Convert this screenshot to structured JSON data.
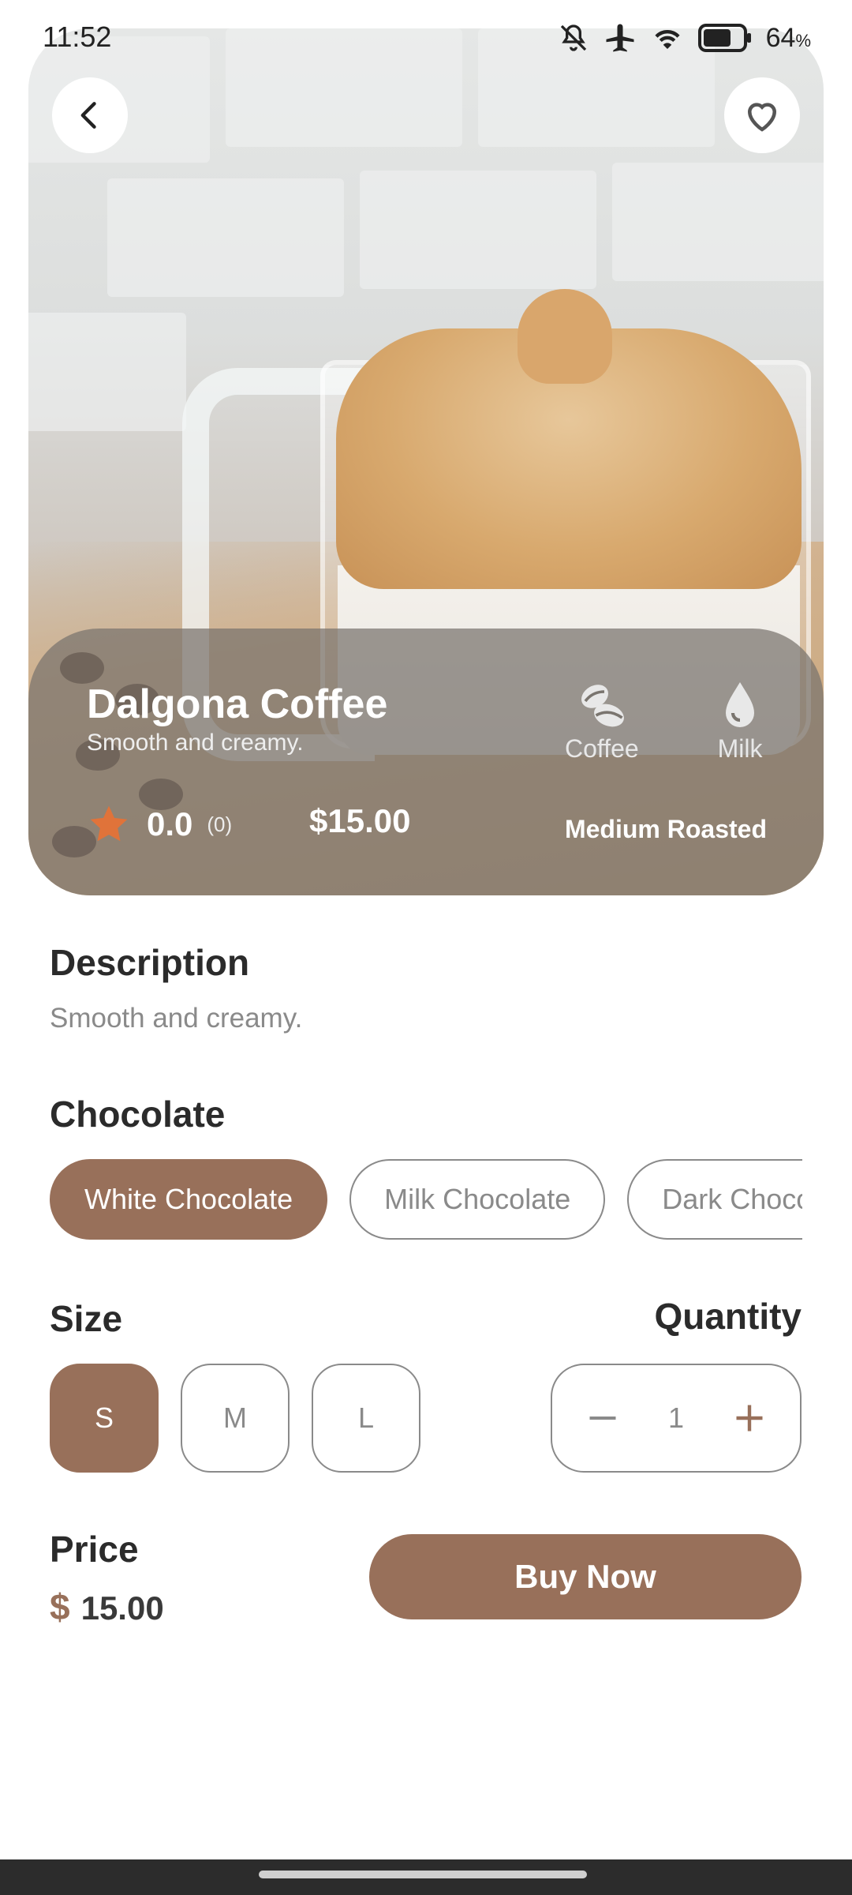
{
  "status_bar": {
    "time": "11:52",
    "battery_percent": "64",
    "battery_unit": "%",
    "icons": [
      "mute-icon",
      "airplane-icon",
      "wifi-icon",
      "battery-icon"
    ]
  },
  "header": {
    "back_icon": "chevron-left-icon",
    "favorite_icon": "heart-icon"
  },
  "product": {
    "name": "Dalgona Coffee",
    "subtitle": "Smooth and creamy.",
    "rating": "0.0",
    "rating_count": "(0)",
    "price": "$15.00",
    "ingredients": [
      {
        "label": "Coffee",
        "icon": "coffee-bean-icon"
      },
      {
        "label": "Milk",
        "icon": "milk-drop-icon"
      }
    ],
    "roast": "Medium Roasted"
  },
  "description": {
    "title": "Description",
    "text": "Smooth and creamy."
  },
  "chocolate": {
    "title": "Chocolate",
    "options": [
      "White Chocolate",
      "Milk Chocolate",
      "Dark Chocolate"
    ],
    "selected": "White Chocolate"
  },
  "size": {
    "title": "Size",
    "options": [
      "S",
      "M",
      "L"
    ],
    "selected": "S"
  },
  "quantity": {
    "title": "Quantity",
    "value": "1"
  },
  "footer": {
    "price_label": "Price",
    "currency": "$",
    "amount": "15.00",
    "buy_label": "Buy Now"
  },
  "colors": {
    "accent": "#98705a",
    "star": "#e0733a"
  }
}
